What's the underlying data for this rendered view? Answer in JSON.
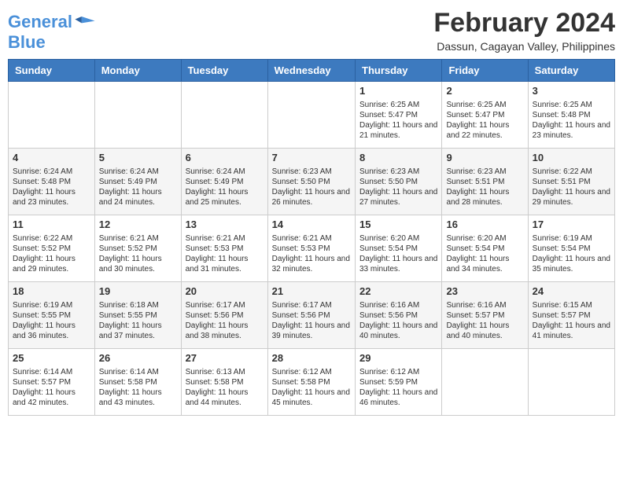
{
  "header": {
    "logo_line1": "General",
    "logo_line2": "Blue",
    "title": "February 2024",
    "subtitle": "Dassun, Cagayan Valley, Philippines"
  },
  "days_of_week": [
    "Sunday",
    "Monday",
    "Tuesday",
    "Wednesday",
    "Thursday",
    "Friday",
    "Saturday"
  ],
  "weeks": [
    [
      {
        "day": "",
        "info": ""
      },
      {
        "day": "",
        "info": ""
      },
      {
        "day": "",
        "info": ""
      },
      {
        "day": "",
        "info": ""
      },
      {
        "day": "1",
        "info": "Sunrise: 6:25 AM\nSunset: 5:47 PM\nDaylight: 11 hours and 21 minutes."
      },
      {
        "day": "2",
        "info": "Sunrise: 6:25 AM\nSunset: 5:47 PM\nDaylight: 11 hours and 22 minutes."
      },
      {
        "day": "3",
        "info": "Sunrise: 6:25 AM\nSunset: 5:48 PM\nDaylight: 11 hours and 23 minutes."
      }
    ],
    [
      {
        "day": "4",
        "info": "Sunrise: 6:24 AM\nSunset: 5:48 PM\nDaylight: 11 hours and 23 minutes."
      },
      {
        "day": "5",
        "info": "Sunrise: 6:24 AM\nSunset: 5:49 PM\nDaylight: 11 hours and 24 minutes."
      },
      {
        "day": "6",
        "info": "Sunrise: 6:24 AM\nSunset: 5:49 PM\nDaylight: 11 hours and 25 minutes."
      },
      {
        "day": "7",
        "info": "Sunrise: 6:23 AM\nSunset: 5:50 PM\nDaylight: 11 hours and 26 minutes."
      },
      {
        "day": "8",
        "info": "Sunrise: 6:23 AM\nSunset: 5:50 PM\nDaylight: 11 hours and 27 minutes."
      },
      {
        "day": "9",
        "info": "Sunrise: 6:23 AM\nSunset: 5:51 PM\nDaylight: 11 hours and 28 minutes."
      },
      {
        "day": "10",
        "info": "Sunrise: 6:22 AM\nSunset: 5:51 PM\nDaylight: 11 hours and 29 minutes."
      }
    ],
    [
      {
        "day": "11",
        "info": "Sunrise: 6:22 AM\nSunset: 5:52 PM\nDaylight: 11 hours and 29 minutes."
      },
      {
        "day": "12",
        "info": "Sunrise: 6:21 AM\nSunset: 5:52 PM\nDaylight: 11 hours and 30 minutes."
      },
      {
        "day": "13",
        "info": "Sunrise: 6:21 AM\nSunset: 5:53 PM\nDaylight: 11 hours and 31 minutes."
      },
      {
        "day": "14",
        "info": "Sunrise: 6:21 AM\nSunset: 5:53 PM\nDaylight: 11 hours and 32 minutes."
      },
      {
        "day": "15",
        "info": "Sunrise: 6:20 AM\nSunset: 5:54 PM\nDaylight: 11 hours and 33 minutes."
      },
      {
        "day": "16",
        "info": "Sunrise: 6:20 AM\nSunset: 5:54 PM\nDaylight: 11 hours and 34 minutes."
      },
      {
        "day": "17",
        "info": "Sunrise: 6:19 AM\nSunset: 5:54 PM\nDaylight: 11 hours and 35 minutes."
      }
    ],
    [
      {
        "day": "18",
        "info": "Sunrise: 6:19 AM\nSunset: 5:55 PM\nDaylight: 11 hours and 36 minutes."
      },
      {
        "day": "19",
        "info": "Sunrise: 6:18 AM\nSunset: 5:55 PM\nDaylight: 11 hours and 37 minutes."
      },
      {
        "day": "20",
        "info": "Sunrise: 6:17 AM\nSunset: 5:56 PM\nDaylight: 11 hours and 38 minutes."
      },
      {
        "day": "21",
        "info": "Sunrise: 6:17 AM\nSunset: 5:56 PM\nDaylight: 11 hours and 39 minutes."
      },
      {
        "day": "22",
        "info": "Sunrise: 6:16 AM\nSunset: 5:56 PM\nDaylight: 11 hours and 40 minutes."
      },
      {
        "day": "23",
        "info": "Sunrise: 6:16 AM\nSunset: 5:57 PM\nDaylight: 11 hours and 40 minutes."
      },
      {
        "day": "24",
        "info": "Sunrise: 6:15 AM\nSunset: 5:57 PM\nDaylight: 11 hours and 41 minutes."
      }
    ],
    [
      {
        "day": "25",
        "info": "Sunrise: 6:14 AM\nSunset: 5:57 PM\nDaylight: 11 hours and 42 minutes."
      },
      {
        "day": "26",
        "info": "Sunrise: 6:14 AM\nSunset: 5:58 PM\nDaylight: 11 hours and 43 minutes."
      },
      {
        "day": "27",
        "info": "Sunrise: 6:13 AM\nSunset: 5:58 PM\nDaylight: 11 hours and 44 minutes."
      },
      {
        "day": "28",
        "info": "Sunrise: 6:12 AM\nSunset: 5:58 PM\nDaylight: 11 hours and 45 minutes."
      },
      {
        "day": "29",
        "info": "Sunrise: 6:12 AM\nSunset: 5:59 PM\nDaylight: 11 hours and 46 minutes."
      },
      {
        "day": "",
        "info": ""
      },
      {
        "day": "",
        "info": ""
      }
    ]
  ]
}
